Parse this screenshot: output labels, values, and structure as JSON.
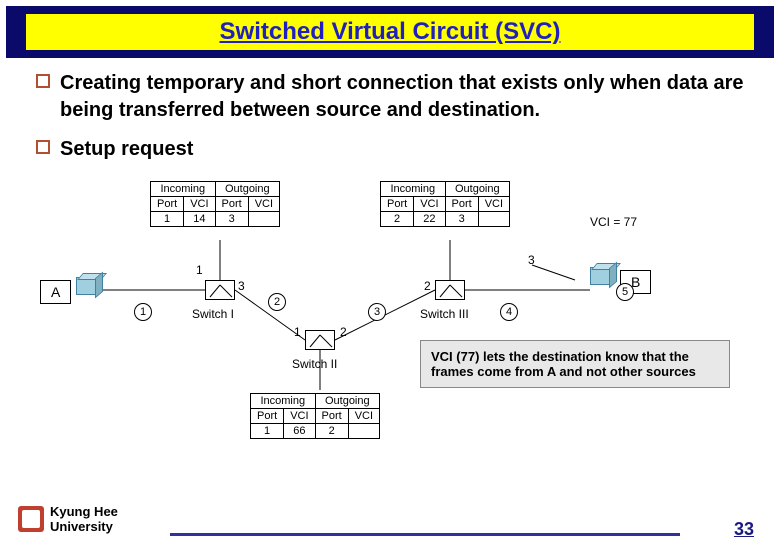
{
  "title": "Switched Virtual Circuit (SVC)",
  "bullets": {
    "b1": "Creating temporary and short connection that exists only when data are being transferred between source and destination.",
    "b2": "Setup request"
  },
  "tables": {
    "hdr_in": "Incoming",
    "hdr_out": "Outgoing",
    "col_port": "Port",
    "col_vci": "VCI",
    "sw1": {
      "in_port": "1",
      "in_vci": "14",
      "out_port": "3",
      "out_vci": ""
    },
    "sw2": {
      "in_port": "1",
      "in_vci": "66",
      "out_port": "2",
      "out_vci": ""
    },
    "sw3": {
      "in_port": "2",
      "in_vci": "22",
      "out_port": "3",
      "out_vci": ""
    }
  },
  "labels": {
    "A": "A",
    "B": "B",
    "sw1": "Switch I",
    "sw2": "Switch II",
    "sw3": "Switch III",
    "vci77": "VCI = 77",
    "p1": "1",
    "p2": "2",
    "p3": "3"
  },
  "steps": {
    "s1": "1",
    "s2": "2",
    "s3": "3",
    "s4": "4",
    "s5": "5"
  },
  "note": "VCI (77) lets the destination know that the frames come from  A and not other sources",
  "footer": {
    "uni": "Kyung Hee\nUniversity",
    "page": "33"
  }
}
